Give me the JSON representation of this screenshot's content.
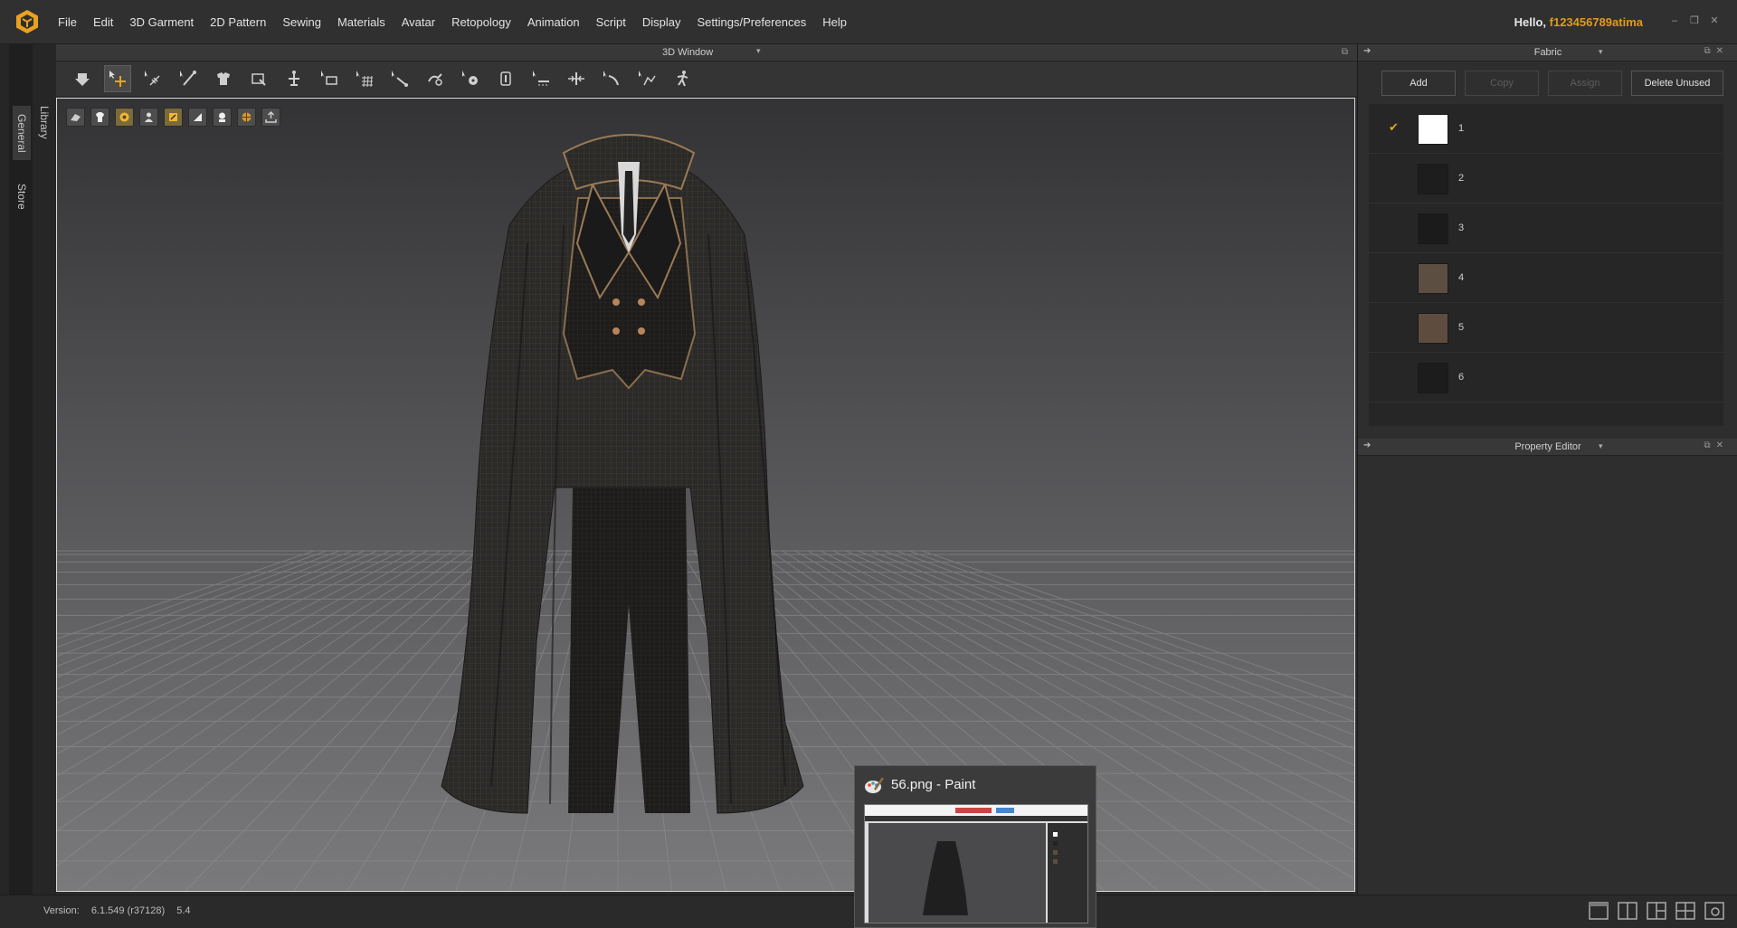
{
  "menubar": {
    "items": [
      "File",
      "Edit",
      "3D Garment",
      "2D Pattern",
      "Sewing",
      "Materials",
      "Avatar",
      "Retopology",
      "Animation",
      "Script",
      "Display",
      "Settings/Preferences",
      "Help"
    ],
    "greeting_prefix": "Hello, ",
    "username": "f123456789atima",
    "minimize": "–",
    "restore": "❐",
    "close": "✕"
  },
  "left_tabs": {
    "general": "General",
    "library": "Library",
    "store": "Store"
  },
  "panel3d": {
    "title": "3D Window",
    "caret": "▾",
    "float": "⧉"
  },
  "toolbar": {
    "tools": [
      "simulation",
      "select-move",
      "select-mesh",
      "pin",
      "fold-arrange",
      "transform-pattern",
      "hanger",
      "measure-circumference",
      "grid",
      "tape-line",
      "strap",
      "button",
      "buttonhole",
      "topstitch",
      "zipper",
      "piping",
      "puckering",
      "avatar-pose"
    ],
    "active_index": 1
  },
  "view_icons": [
    "texture-view",
    "shaded-view",
    "fabric-rainbow",
    "avatar-view",
    "highlight-view",
    "cube-view",
    "avatar-bust",
    "wireframe-globe",
    "export-view"
  ],
  "fabric_panel": {
    "title": "Fabric",
    "buttons": {
      "add": "Add",
      "copy": "Copy",
      "assign": "Assign",
      "delete_unused": "Delete Unused"
    },
    "check": "✔",
    "items": [
      {
        "label": "1",
        "color": "#ffffff",
        "checked": true
      },
      {
        "label": "2",
        "color": "#1d1d1d",
        "checked": false
      },
      {
        "label": "3",
        "color": "#1b1b1b",
        "checked": false
      },
      {
        "label": "4",
        "color": "#5d4e42",
        "checked": false
      },
      {
        "label": "5",
        "color": "#5e4d3f",
        "checked": false
      },
      {
        "label": "6",
        "color": "#1c1c1c",
        "checked": false
      }
    ]
  },
  "property_panel": {
    "title": "Property Editor"
  },
  "statusbar": {
    "version_label": "Version:",
    "version": "6.1.549 (r37128)",
    "build": "5.4"
  },
  "taskbar_thumb": {
    "title": "56.png - Paint"
  },
  "colors": {
    "accent": "#e49a1a",
    "check": "#e2a628",
    "background": "#2b2b2b"
  }
}
